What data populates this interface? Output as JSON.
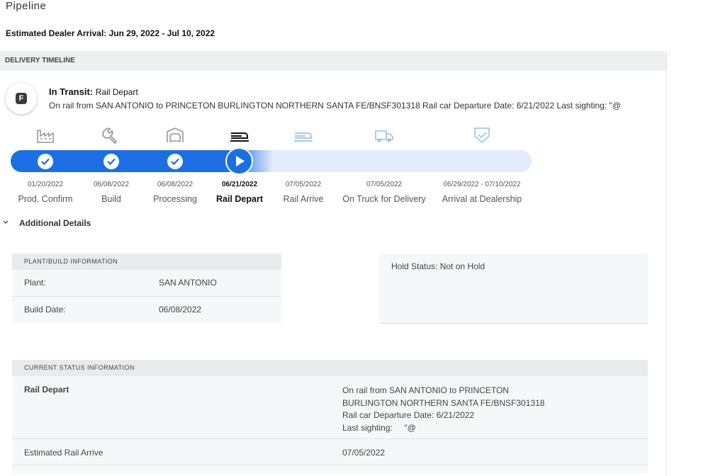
{
  "page": {
    "title": "Pipeline",
    "arrival": "Estimated Dealer Arrival: Jun 29, 2022 - Jul 10, 2022"
  },
  "timeline": {
    "header": "DELIVERY TIMELINE",
    "badge_letter": "F",
    "status_prefix": "In Transit:",
    "status_stage": "Rail Depart",
    "status_description": "On rail from SAN ANTONIO to PRINCETON BURLINGTON NORTHERN SANTA FE/BNSF301318 Rail car Departure Date: 6/21/2022 Last sighting: \"@",
    "stages": [
      {
        "date": "01/20/2022",
        "label": "Prod. Confirm",
        "icon": "factory-icon",
        "state": "complete"
      },
      {
        "date": "06/08/2022",
        "label": "Build",
        "icon": "wrench-icon",
        "state": "complete"
      },
      {
        "date": "06/08/2022",
        "label": "Processing",
        "icon": "car-processing-icon",
        "state": "complete"
      },
      {
        "date": "06/21/2022",
        "label": "Rail Depart",
        "icon": "rail-car-icon",
        "state": "current"
      },
      {
        "date": "07/05/2022",
        "label": "Rail Arrive",
        "icon": "rail-car-icon",
        "state": "upcoming"
      },
      {
        "date": "07/05/2022",
        "label": "On Truck for Delivery",
        "icon": "truck-icon",
        "state": "upcoming"
      },
      {
        "date": "06/29/2022 - 07/10/2022",
        "label": "Arrival at Dealership",
        "icon": "shield-check-icon",
        "state": "upcoming"
      }
    ],
    "colors": {
      "progress": "#1b6fe3",
      "track": "#e3ecfb",
      "inactive_icon": "#a9c7e6",
      "done_icon": "#999999"
    }
  },
  "additional": {
    "toggle_label": "Additional Details",
    "plant": {
      "header": "PLANT/BUILD INFORMATION",
      "plant_key": "Plant:",
      "plant_value": "SAN ANTONIO",
      "build_key": "Build Date:",
      "build_value": "06/08/2022"
    },
    "hold": {
      "text": "Hold Status: Not on Hold"
    },
    "current_status": {
      "header": "CURRENT STATUS INFORMATION",
      "stage": "Rail Depart",
      "lines": [
        "On rail from SAN ANTONIO to PRINCETON",
        "BURLINGTON NORTHERN SANTA FE/BNSF301318",
        "Rail car Departure Date: 6/21/2022",
        "Last sighting:     \"@"
      ],
      "est_key": "Estimated Rail Arrive",
      "est_value": "07/05/2022"
    }
  }
}
